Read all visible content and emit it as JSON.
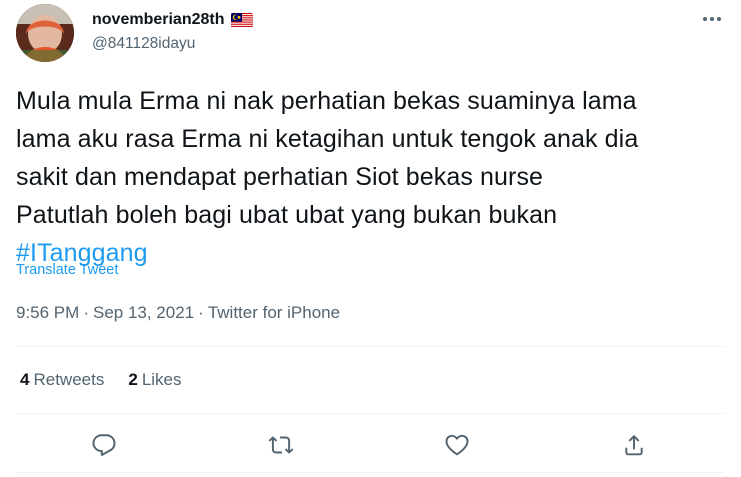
{
  "user": {
    "display_name": "novemberian28th",
    "handle": "@841128idayu",
    "flag_icon": "malaysia-flag-icon"
  },
  "tweet": {
    "lines": [
      "Mula mula Erma ni nak perhatian bekas suaminya lama",
      "lama aku rasa Erma ni ketagihan untuk tengok anak dia",
      "sakit dan mendapat perhatian Siot bekas nurse",
      "Patutlah boleh bagi ubat ubat yang bukan bukan"
    ],
    "hashtag": "#ITanggang",
    "translate_label": "Translate Tweet",
    "time": "9:56 PM",
    "date": "Sep 13, 2021",
    "separator": "·",
    "source": "Twitter for iPhone"
  },
  "stats": {
    "retweets_count": "4",
    "retweets_label": "Retweets",
    "likes_count": "2",
    "likes_label": "Likes"
  },
  "actions": [
    "reply-icon",
    "retweet-icon",
    "like-icon",
    "share-icon"
  ],
  "colors": {
    "link": "#1d9bf0",
    "text": "#0f1419",
    "secondary": "#536471",
    "divider": "#eff3f4"
  }
}
